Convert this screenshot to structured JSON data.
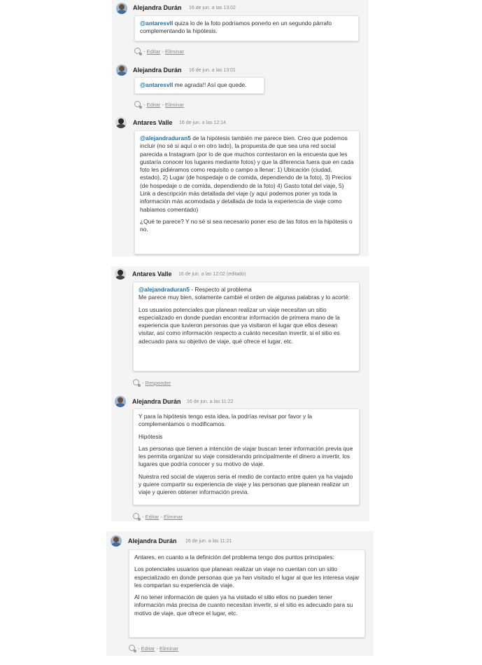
{
  "comments": [
    {
      "author": "Alejandra Durán",
      "time": "16 de jun. a las 13:02",
      "paragraphs": [
        {
          "mention": "@antaresvll",
          "text": " quiza lo de la foto podríamos ponerlo en un segundo párrafo complementando la hipótesis."
        }
      ],
      "actions": {
        "first": "Editar",
        "sep": " - ",
        "second": "Eliminar"
      }
    },
    {
      "author": "Alejandra Durán",
      "time": "16 de jun. a las 13:01",
      "paragraphs": [
        {
          "mention": "@antaresvll",
          "text": " me agrada!! Así que quede."
        }
      ],
      "actions": {
        "first": "Editar",
        "sep": " - ",
        "second": "Eliminar"
      }
    },
    {
      "author": "Antares Valle",
      "time": "16 de jun. a las 12:14",
      "paragraphs": [
        {
          "mention": "@alejandraduran5",
          "text": " de la hipótesis también me parece bien. Creo que podemos incluir (no sé si aquí o en otro lado), la propuesta de que sea una red social parecida a Instagram (por lo de que muchos contestaron en la encuesta que les gustaría conocer los lugares mediante fotos) y que la diferencia fuera que en cada foto les pidiéramos como requisito o campo a llenar: 1) Ubicación (ciudad, estado), 2) Lugar (de hospedaje o de comida, dependiendo de la foto), 3) Precios (de hospedaje o de comida, dependiendo de la foto) 4) Gasto total del viaje, 5) Link a descripción más detallada del viaje (y aquí podemos poner ya toda la información más acomodada y detallada de toda la experiencia de viaje como habíamos comentado)"
        },
        {
          "mention": "",
          "text": "¿Qué te parece? Y no sé si sea necesario poner eso de las fotos en la hipótesis o no."
        }
      ],
      "actions": null
    },
    {
      "author": "Antares Valle",
      "time": "16 de jun. a las 12:02 (editado)",
      "paragraphs": [
        {
          "mention": "@alejandraduran5",
          "text": " - Respecto al problema\nMe parece muy bien, solamente cambié el orden de algunas palabras y lo acorté:"
        },
        {
          "mention": "",
          "text": "Los usuarios potenciales que planean realizar un viaje necesitan un sitio especializado en donde puedan encontrar información de primera mano de la experiencia que tuvieron personas que ya visitaron el lugar que ellos desean visitar, así como información respecto a cuánto necesitan invertir, si el sitio es adecuado para su objetivo de viaje, qué ofrece el lugar, etc."
        }
      ],
      "actions": {
        "first": "Responder",
        "sep": "",
        "second": ""
      }
    },
    {
      "author": "Alejandra Durán",
      "time": "16 de jun. a las 11:22",
      "paragraphs": [
        {
          "mention": "",
          "text": "Y para la hipótesis tengo esta idea, la podrías revisar por favor y la complementamos o modificamos."
        },
        {
          "mention": "",
          "text": "Hipótesis"
        },
        {
          "mention": "",
          "text": "Las personas que tienen a intención de viajar buscan tener información previa que les permita organizar su viaje considerando principalmente el dinero a invertir, los lugares que podría conocer y su motivo de viaje."
        },
        {
          "mention": "",
          "text": "Nuestra red social de viajeros seria el medio de contacto entre quien ya ha viajado y quiere compartir su experiencia de viaje y las personas que planean realizar un viaje y quieren obtener información previa."
        }
      ],
      "actions": {
        "first": "Editar",
        "sep": " - ",
        "second": "Eliminar"
      }
    },
    {
      "author": "Alejandra Durán",
      "time": "16 de jun. a las 11:21",
      "paragraphs": [
        {
          "mention": "",
          "text": "Antares, en cuanto a la definición del problema tengo dos puntos principales:"
        },
        {
          "mention": "",
          "text": "Los potenciales usuarios que planean realizar un viaje no cuentan con un sitio especializado en donde personas que ya han visitado el lugar al que les interesa viajar les compartan su experiencia de viaje."
        },
        {
          "mention": "",
          "text": "Al no tener información de quien ya ha visitado el sitio ellos no pueden tener información más precisa de cuanto necesitan invertir, si el sitio es adecuado para su motivo de viaje, que ofrece el lugar, etc."
        }
      ],
      "actions": {
        "first": "Editar",
        "sep": " - ",
        "second": "Eliminar"
      }
    }
  ]
}
